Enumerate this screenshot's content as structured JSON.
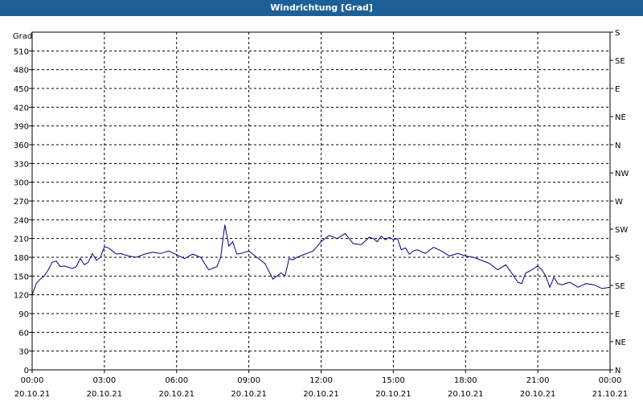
{
  "window": {
    "title": "Windrichtung [Grad]"
  },
  "chart_data": {
    "type": "line",
    "title": "Windrichtung [Grad]",
    "ylabel": "Grad",
    "ylim": [
      0,
      540
    ],
    "yticks": [
      0,
      30,
      60,
      90,
      120,
      150,
      180,
      210,
      240,
      270,
      300,
      330,
      360,
      390,
      420,
      450,
      480,
      510
    ],
    "right_axis_labels": [
      "N",
      "NE",
      "E",
      "SE",
      "S",
      "SW",
      "W",
      "NW",
      "N",
      "NE",
      "E",
      "SE",
      "S"
    ],
    "right_axis_values": [
      0,
      30,
      60,
      90,
      120,
      150,
      180,
      210,
      240,
      270,
      300,
      330,
      360
    ],
    "xlim": [
      0,
      24
    ],
    "xticks": [
      {
        "time": "00:00",
        "date": "20.10.21"
      },
      {
        "time": "03:00",
        "date": "20.10.21"
      },
      {
        "time": "06:00",
        "date": "20.10.21"
      },
      {
        "time": "09:00",
        "date": "20.10.21"
      },
      {
        "time": "12:00",
        "date": "20.10.21"
      },
      {
        "time": "15:00",
        "date": "20.10.21"
      },
      {
        "time": "18:00",
        "date": "20.10.21"
      },
      {
        "time": "21:00",
        "date": "20.10.21"
      },
      {
        "time": "00:00",
        "date": "21.10.21"
      }
    ],
    "grid": true,
    "series": [
      {
        "color": "#00008b",
        "x": [
          0,
          0.17,
          0.33,
          0.5,
          0.67,
          0.83,
          1.0,
          1.17,
          1.33,
          1.5,
          1.67,
          1.83,
          2.0,
          2.17,
          2.33,
          2.5,
          2.67,
          2.83,
          3.0,
          3.17,
          3.33,
          3.5,
          3.67,
          3.83,
          4.0,
          4.33,
          4.67,
          5.0,
          5.33,
          5.67,
          6.0,
          6.33,
          6.67,
          7.0,
          7.33,
          7.67,
          7.83,
          8.0,
          8.17,
          8.33,
          8.5,
          8.67,
          9.0,
          9.33,
          9.67,
          10.0,
          10.17,
          10.33,
          10.5,
          10.67,
          10.83,
          11.0,
          11.33,
          11.67,
          12.0,
          12.33,
          12.67,
          13.0,
          13.33,
          13.67,
          14.0,
          14.17,
          14.33,
          14.5,
          14.67,
          14.83,
          15.0,
          15.17,
          15.33,
          15.5,
          15.67,
          15.83,
          16.0,
          16.33,
          16.67,
          17.0,
          17.33,
          17.67,
          18.0,
          18.33,
          18.67,
          19.0,
          19.33,
          19.67,
          20.0,
          20.17,
          20.33,
          20.5,
          20.67,
          20.83,
          21.0,
          21.17,
          21.33,
          21.5,
          21.67,
          21.83,
          22.0,
          22.33,
          22.67,
          23.0,
          23.33,
          23.67,
          24.0
        ],
        "y": [
          120,
          138,
          145,
          150,
          160,
          172,
          174,
          165,
          166,
          164,
          162,
          165,
          178,
          168,
          172,
          186,
          175,
          180,
          197,
          195,
          190,
          185,
          186,
          184,
          182,
          180,
          185,
          188,
          186,
          190,
          184,
          178,
          185,
          180,
          160,
          165,
          180,
          232,
          198,
          205,
          185,
          186,
          190,
          180,
          170,
          145,
          150,
          155,
          150,
          178,
          176,
          180,
          185,
          190,
          205,
          215,
          210,
          218,
          202,
          200,
          212,
          210,
          205,
          214,
          208,
          212,
          208,
          210,
          192,
          195,
          185,
          190,
          192,
          186,
          196,
          190,
          182,
          186,
          182,
          180,
          175,
          170,
          160,
          168,
          150,
          140,
          138,
          155,
          158,
          162,
          166,
          160,
          150,
          132,
          148,
          138,
          136,
          140,
          132,
          138,
          136,
          130,
          132
        ]
      }
    ]
  }
}
